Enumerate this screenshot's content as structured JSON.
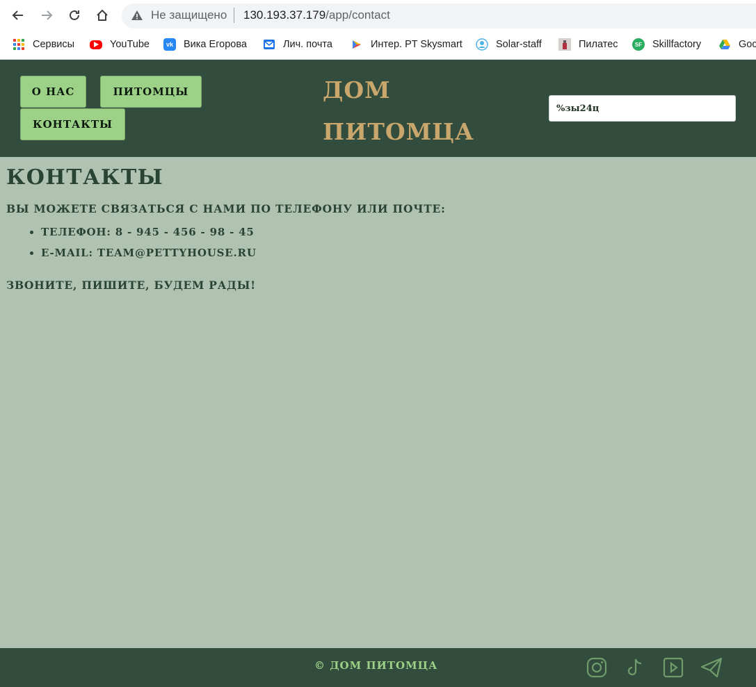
{
  "browser": {
    "security_label": "Не защищено",
    "url_host": "130.193.37.179",
    "url_path": "/app/contact",
    "bookmarks": [
      {
        "label": "Сервисы",
        "icon": "apps-grid-icon"
      },
      {
        "label": "YouTube",
        "icon": "youtube-icon",
        "color": "#ff0000"
      },
      {
        "label": "Вика Егорова",
        "icon": "vk-icon",
        "color": "#2787f5"
      },
      {
        "label": "Лич. почта",
        "icon": "mail-icon",
        "color": "#1a73e8"
      },
      {
        "label": "Интер. PT Skysmart",
        "icon": "play-icon"
      },
      {
        "label": "Solar-staff",
        "icon": "solar-staff-icon",
        "color": "#4fb3e8"
      },
      {
        "label": "Пилатес",
        "icon": "pilates-photo-icon"
      },
      {
        "label": "Skillfactory",
        "icon": "skillfactory-icon",
        "color": "#27ae60"
      },
      {
        "label": "Goc",
        "icon": "google-drive-icon"
      }
    ]
  },
  "header": {
    "nav": [
      {
        "label": "О нас"
      },
      {
        "label": "питомцы"
      },
      {
        "label": "контакты"
      }
    ],
    "logo_line1": "ДОМ",
    "logo_line2": "ПИТОМЦА",
    "search_value": "%зы24ц"
  },
  "main": {
    "title": "Контакты",
    "intro": "Вы можете связаться с нами по телефону или почте:",
    "contacts": [
      "Телефон: 8 - 945 - 456 - 98 - 45",
      "E-mail: team@pettyhouse.ru"
    ],
    "outro": "Звоните, пишите, будем рады!"
  },
  "footer": {
    "copyright": "© дом питомца",
    "social_icons": [
      "instagram-icon",
      "tiktok-icon",
      "youtube-icon",
      "telegram-icon"
    ]
  },
  "colors": {
    "header_bg": "#324d3d",
    "page_bg": "#b0c3b2",
    "button_bg": "#9ed188",
    "logo": "#c9a66b",
    "text": "#294334"
  }
}
